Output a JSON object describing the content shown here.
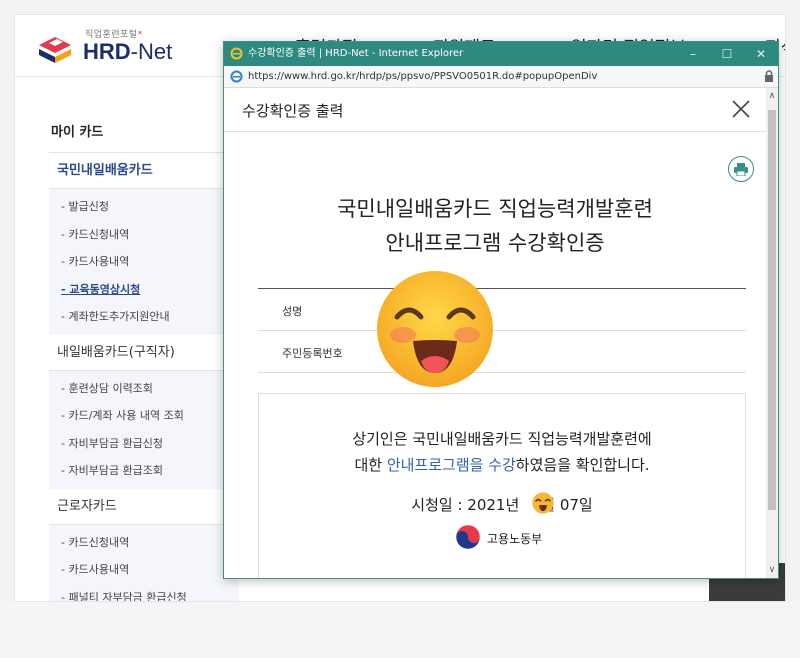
{
  "site": {
    "logo_small": "직업훈련포털",
    "logo_hrd": "HRD",
    "logo_dash": "-",
    "logo_net": "Net",
    "gnb": [
      "훈련과정",
      "지원제도",
      "일자리·직업정보",
      "지식"
    ]
  },
  "lnb": {
    "title": "마이 카드",
    "groups": [
      {
        "label": "국민내일배움카드",
        "items": [
          "발급신청",
          "카드신청내역",
          "카드사용내역",
          "교육동영상시청",
          "계좌한도추가지원안내"
        ]
      },
      {
        "label": "내일배움카드(구직자)",
        "items": [
          "훈련상담 이력조회",
          "카드/계좌 사용 내역 조회",
          "자비부담금 환급신청",
          "자비부담금 환급조회"
        ]
      },
      {
        "label": "근로자카드",
        "items": [
          "카드신청내역",
          "카드사용내역",
          "패널티 자부담금 환급신청"
        ]
      }
    ]
  },
  "popup": {
    "window_title": "수강확인증 출력 | HRD-Net - Internet Explorer",
    "url": "https://www.hrd.go.kr/hrdp/ps/ppsvo/PPSVO0501R.do#popupOpenDiv",
    "title": "수강확인증 출력",
    "cert_title_line1": "국민내일배움카드 직업능력개발훈련",
    "cert_title_line2": "안내프로그램 수강확인증",
    "rows": [
      {
        "label": "성명"
      },
      {
        "label": "주민등록번호"
      }
    ],
    "statement_line1": "상기인은 국민내일배움카드 직업능력개발훈련에",
    "statement_pre": "대한 ",
    "statement_highlight": "안내프로그램을 수강",
    "statement_post": "하였음을 확인합니다.",
    "date_prefix": "시청일 : 2021년",
    "date_suffix": "월 07일",
    "ministry": "고용노동부"
  },
  "colors": {
    "titlebar": "#2e8a7e",
    "highlight": "#2f63b1",
    "nav_active": "#2b4a8c"
  },
  "icons": {
    "print": "printer-icon",
    "close": "close-icon",
    "ie": "internet-explorer-icon",
    "lock": "lock-icon",
    "ministry_logo": "taegeuk-icon",
    "emoji": "smiling-face-emoji"
  }
}
